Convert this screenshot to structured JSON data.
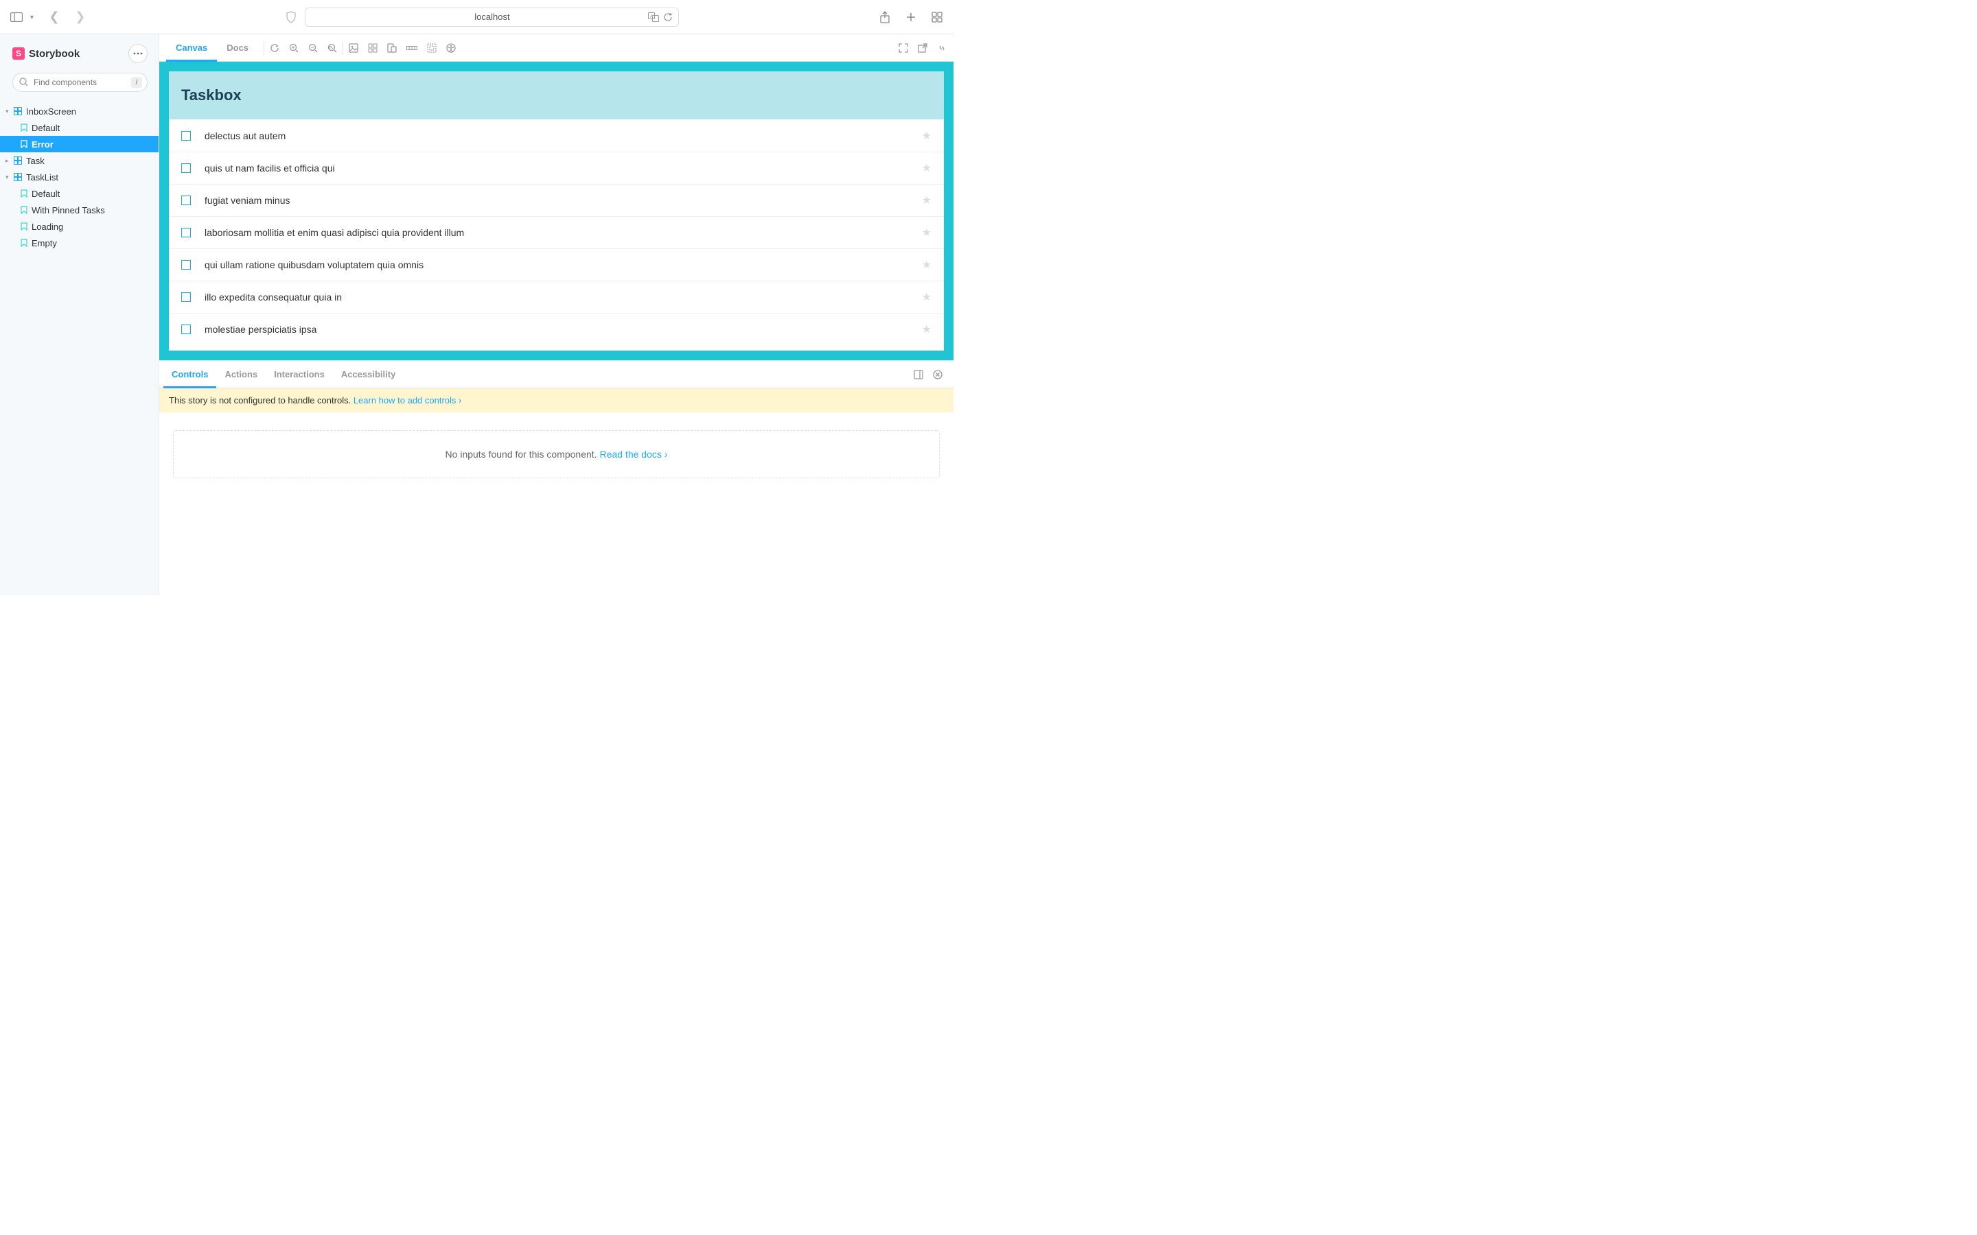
{
  "browser": {
    "url": "localhost"
  },
  "app": {
    "name": "Storybook",
    "search_placeholder": "Find components",
    "search_key": "/"
  },
  "tree": [
    {
      "type": "component",
      "label": "InboxScreen",
      "expanded": true,
      "stories": [
        {
          "label": "Default",
          "selected": false
        },
        {
          "label": "Error",
          "selected": true
        }
      ]
    },
    {
      "type": "component",
      "label": "Task",
      "expanded": false,
      "stories": []
    },
    {
      "type": "component",
      "label": "TaskList",
      "expanded": true,
      "stories": [
        {
          "label": "Default",
          "selected": false
        },
        {
          "label": "With Pinned Tasks",
          "selected": false
        },
        {
          "label": "Loading",
          "selected": false
        },
        {
          "label": "Empty",
          "selected": false
        }
      ]
    }
  ],
  "toolbar": {
    "tabs": [
      "Canvas",
      "Docs"
    ],
    "active_tab": "Canvas"
  },
  "preview": {
    "title": "Taskbox",
    "tasks": [
      "delectus aut autem",
      "quis ut nam facilis et officia qui",
      "fugiat veniam minus",
      "laboriosam mollitia et enim quasi adipisci quia provident illum",
      "qui ullam ratione quibusdam voluptatem quia omnis",
      "illo expedita consequatur quia in",
      "molestiae perspiciatis ipsa"
    ]
  },
  "addons": {
    "tabs": [
      "Controls",
      "Actions",
      "Interactions",
      "Accessibility"
    ],
    "active_tab": "Controls",
    "warning_prefix": "This story is not configured to handle controls. ",
    "warning_link": "Learn how to add controls",
    "empty_prefix": "No inputs found for this component. ",
    "empty_link": "Read the docs"
  }
}
